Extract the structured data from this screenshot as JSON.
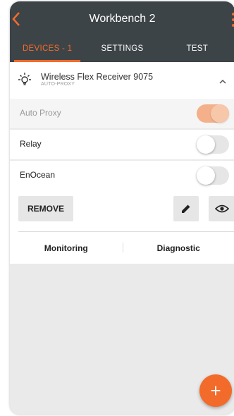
{
  "header": {
    "title": "Workbench 2",
    "back_icon": "chevron-left-icon",
    "menu_icon": "kebab-menu-icon"
  },
  "tabs": [
    {
      "label": "DEVICES - 1",
      "active": true
    },
    {
      "label": "SETTINGS",
      "active": false
    },
    {
      "label": "TEST",
      "active": false
    }
  ],
  "device": {
    "name": "Wireless Flex Receiver 9075",
    "subtitle": "AUTO-PROXY",
    "icon": "light-bulb-icon",
    "expand_icon": "chevron-up-icon"
  },
  "settings": [
    {
      "label": "Auto Proxy",
      "enabled": true,
      "disabled": true
    },
    {
      "label": "Relay",
      "enabled": false,
      "disabled": false
    },
    {
      "label": "EnOcean",
      "enabled": false,
      "disabled": false
    }
  ],
  "actions": {
    "remove_label": "REMOVE",
    "edit_icon": "pencil-icon",
    "view_icon": "eye-icon"
  },
  "bottom_tabs": [
    {
      "label": "Monitoring"
    },
    {
      "label": "Diagnostic"
    }
  ],
  "fab": {
    "icon": "plus-icon",
    "label": "+"
  },
  "colors": {
    "accent": "#f26b2a",
    "header_bg": "#3d4448",
    "page_bg": "#eaeaea"
  }
}
